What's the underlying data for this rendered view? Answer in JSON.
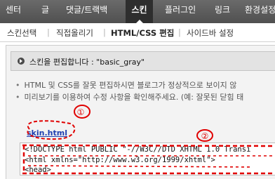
{
  "topnav": {
    "tabs": [
      {
        "label": "센터"
      },
      {
        "label": "글"
      },
      {
        "label": "댓글/트랙백"
      },
      {
        "label": "스킨"
      },
      {
        "label": "플러그인"
      },
      {
        "label": "링크"
      },
      {
        "label": "환경설정"
      }
    ],
    "active_tab": "스킨"
  },
  "subnav": {
    "items": [
      {
        "label": "스킨선택"
      },
      {
        "label": "직접올리기"
      },
      {
        "label": "HTML/CSS 편집"
      },
      {
        "label": "사이드바 설정"
      }
    ],
    "separator": "|",
    "current": "HTML/CSS 편집"
  },
  "editor": {
    "title": "스킨을 편집합니다 : \"basic_gray\"",
    "notices": [
      {
        "bullet": "•",
        "text": "HTML 및 CSS를 잘못 편집하시면 블로그가 정상적으로 보이지 않"
      },
      {
        "bullet": "•",
        "text": "미리보기를 이용하여 수정 사항을 확인해주세요. (예: 잘못된 닫힘 태"
      }
    ],
    "file_link": "skin.html",
    "code_lines": [
      "<!DOCTYPE html PUBLIC \"-//W3C//DTD XHTML 1.0 Transi",
      "<html xmlns=\"http://www.w3.org/1999/xhtml\">",
      "<head>"
    ]
  },
  "annotations": {
    "label_1": "①",
    "label_2": "②",
    "color": "#e00000"
  }
}
